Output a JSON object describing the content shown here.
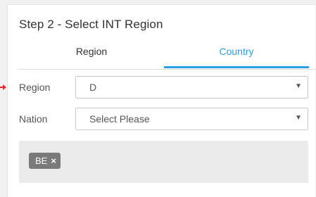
{
  "step_title": "Step 2 - Select INT Region",
  "tabs": [
    {
      "label": "Region",
      "active": false
    },
    {
      "label": "Country",
      "active": true
    }
  ],
  "region_field": {
    "label": "Region",
    "value": "D"
  },
  "nation_field": {
    "label": "Nation",
    "value": "Select Please"
  },
  "selected_tags": [
    {
      "label": "BE",
      "remove_glyph": "×"
    }
  ],
  "icons": {
    "dropdown": "caret-down-icon",
    "remove": "close-icon",
    "pointer": "arrow-right-icon"
  },
  "colors": {
    "accent": "#2b9fe3",
    "tag_bg": "#7a7a7a",
    "pointer": "#d9302c"
  }
}
